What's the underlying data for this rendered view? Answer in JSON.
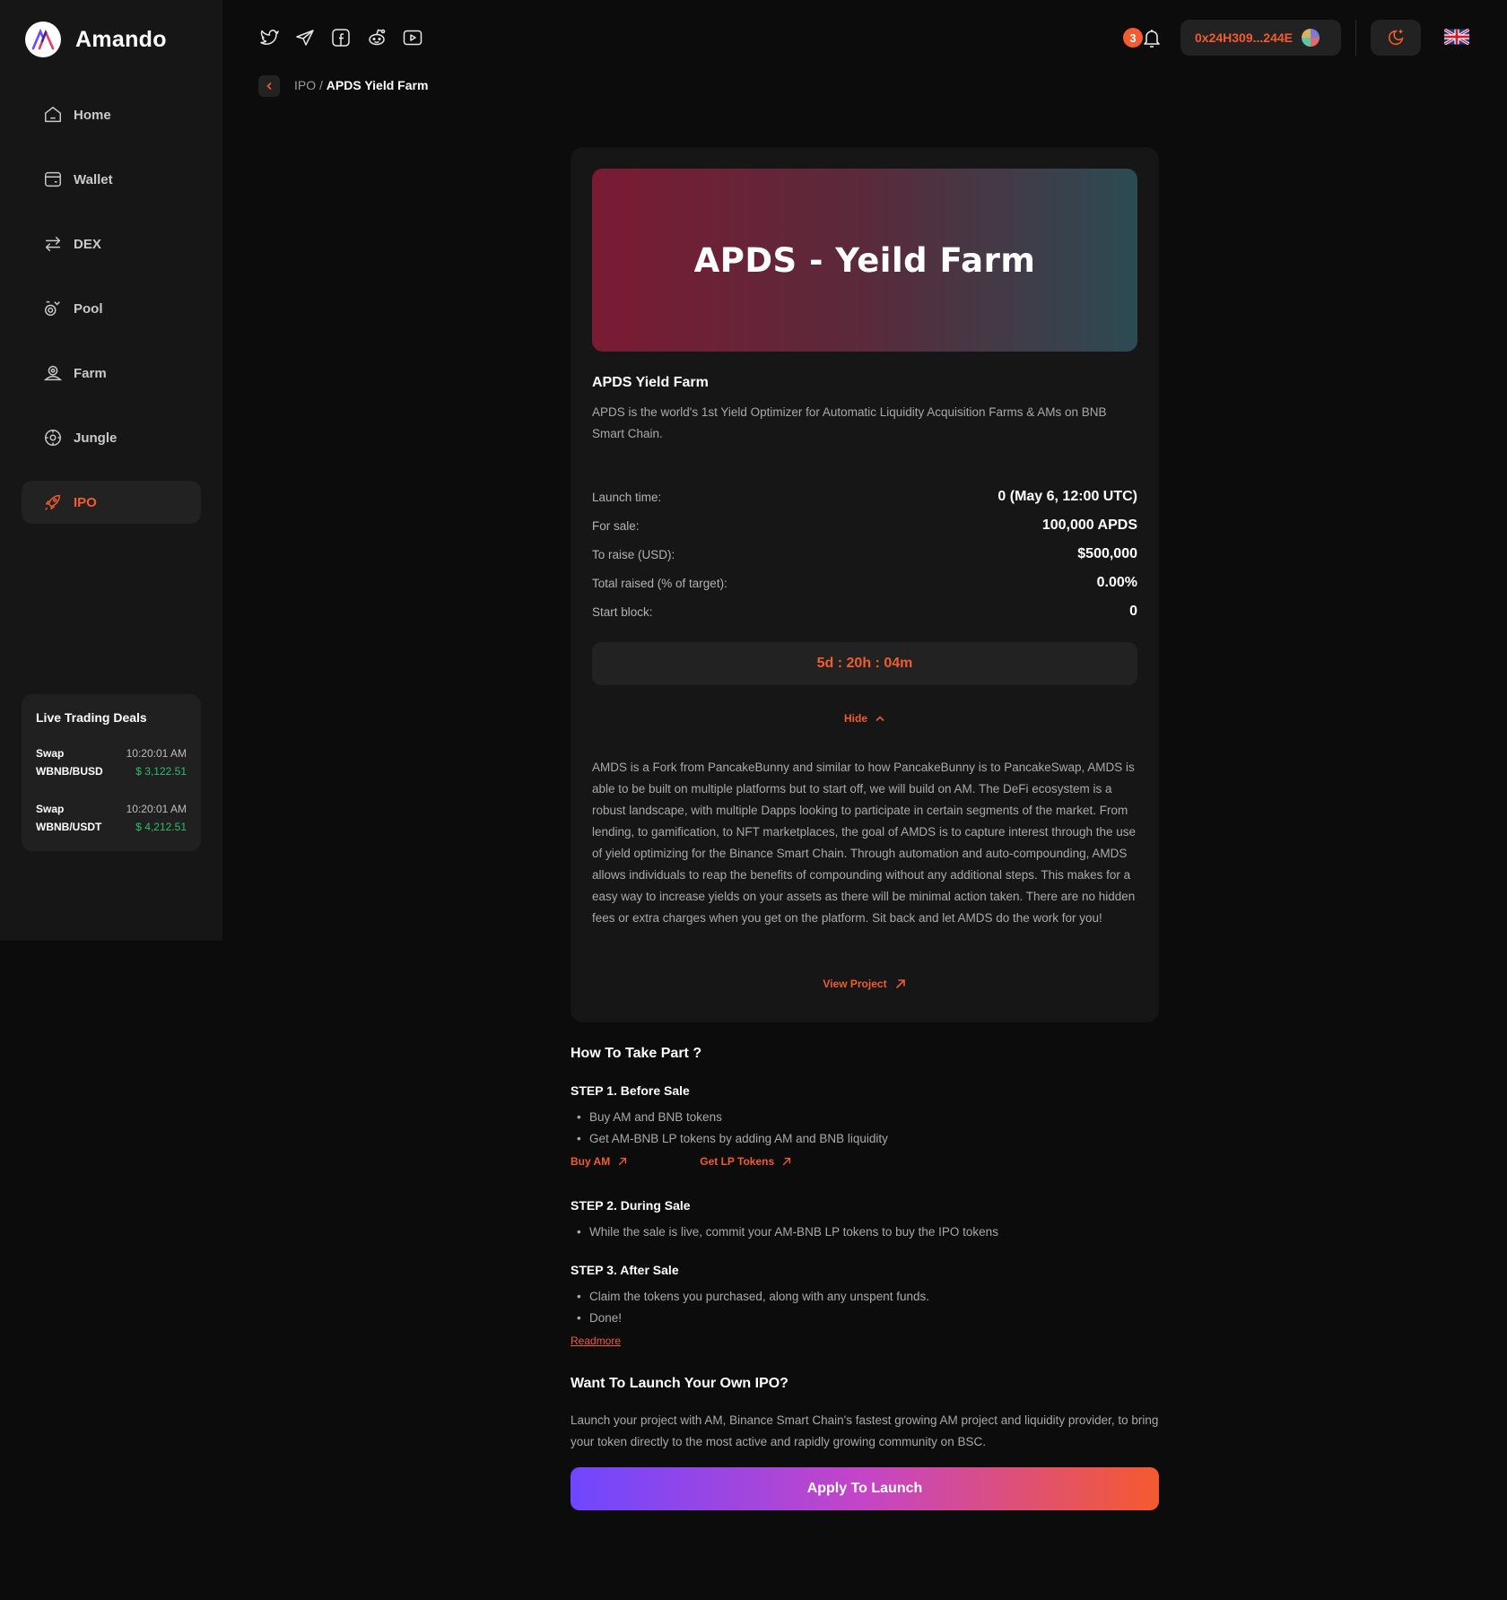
{
  "brand": {
    "name": "Amando"
  },
  "sidebar": {
    "items": [
      {
        "label": "Home",
        "icon": "home-icon"
      },
      {
        "label": "Wallet",
        "icon": "wallet-icon"
      },
      {
        "label": "DEX",
        "icon": "swap-icon"
      },
      {
        "label": "Pool",
        "icon": "pool-icon"
      },
      {
        "label": "Farm",
        "icon": "farm-icon"
      },
      {
        "label": "Jungle",
        "icon": "jungle-icon"
      },
      {
        "label": "IPO",
        "icon": "rocket-icon",
        "active": true
      }
    ],
    "deals": {
      "title": "Live Trading Deals",
      "items": [
        {
          "type": "Swap",
          "time": "10:20:01 AM",
          "pair": "WBNB/BUSD",
          "price": "$ 3,122.51"
        },
        {
          "type": "Swap",
          "time": "10:20:01 AM",
          "pair": "WBNB/USDT",
          "price": "$ 4,212.51"
        }
      ]
    }
  },
  "header": {
    "socials": [
      "twitter-icon",
      "telegram-icon",
      "facebook-icon",
      "reddit-icon",
      "youtube-icon"
    ],
    "notification_count": "3",
    "wallet_address": "0x24H309...244E",
    "language": "uk-flag-icon"
  },
  "breadcrumb": {
    "parent": "IPO",
    "separator": "/",
    "current": "APDS Yield Farm"
  },
  "card": {
    "banner_title": "APDS - Yeild Farm",
    "title": "APDS Yield Farm",
    "description": "APDS is the world's 1st Yield Optimizer for Automatic Liquidity Acquisition Farms & AMs on BNB Smart Chain.",
    "stats": [
      {
        "label": "Launch time:",
        "value": "0 (May 6, 12:00 UTC)"
      },
      {
        "label": "For sale:",
        "value": "100,000 APDS"
      },
      {
        "label": "To raise (USD):",
        "value": "$500,000"
      },
      {
        "label": "Total raised (% of target):",
        "value": "0.00%"
      },
      {
        "label": "Start block:",
        "value": "0"
      }
    ],
    "countdown": "5d : 20h : 04m",
    "hide_label": "Hide",
    "long_description": "AMDS is a Fork from PancakeBunny and similar to how PancakeBunny is to PancakeSwap, AMDS is able to be built on multiple platforms but to start off, we will build on AM. The DeFi ecosystem is a robust landscape, with multiple Dapps looking to participate in certain segments of the market. From lending, to gamification, to NFT marketplaces, the goal of AMDS is to capture interest through the use of yield optimizing for the Binance Smart Chain. Through automation and auto-compounding, AMDS allows individuals to reap the benefits of compounding without any additional steps. This makes for a easy way to increase yields on your assets as there will be minimal action taken. There are no hidden fees or extra charges when you get on the platform. Sit back and let AMDS do the work for you!",
    "view_project_label": "View Project"
  },
  "how_to": {
    "title": "How To Take Part ?",
    "step1": {
      "title": "STEP 1. Before Sale",
      "bullets": [
        "Buy AM and BNB tokens",
        "Get AM-BNB LP tokens by adding AM and BNB liquidity"
      ],
      "links": [
        "Buy AM",
        "Get LP Tokens"
      ]
    },
    "step2": {
      "title": "STEP 2. During Sale",
      "bullets": [
        "While the sale is live, commit your AM-BNB LP tokens to buy the IPO tokens"
      ]
    },
    "step3": {
      "title": "STEP 3. After Sale",
      "bullets": [
        "Claim the tokens you purchased, along with any unspent funds.",
        "Done!"
      ]
    },
    "readmore": "Readmore"
  },
  "launch": {
    "title": "Want To Launch Your Own IPO?",
    "description": "Launch your project with AM, Binance Smart Chain's fastest growing AM project and liquidity provider, to bring your token directly to the most active and rapidly growing community on BSC.",
    "button": "Apply To Launch"
  },
  "colors": {
    "accent": "#f25c2e",
    "positive": "#2ebd6b",
    "background": "#0c0c0c",
    "panel": "#161616"
  }
}
